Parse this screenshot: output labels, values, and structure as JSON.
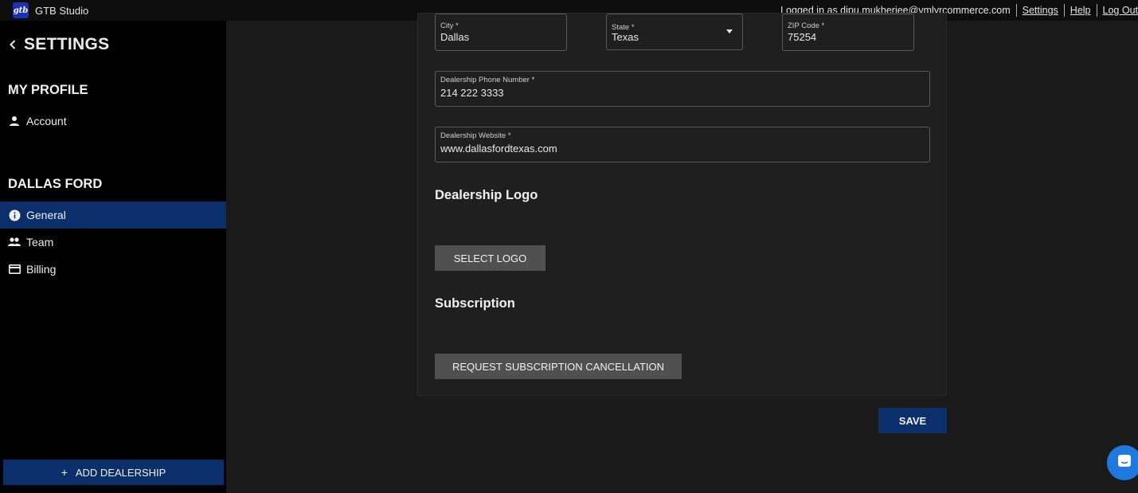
{
  "header": {
    "logo_text": "gtb",
    "app_title": "GTB Studio",
    "logged_in_text": "Logged in as dipu.mukherjee@vmlyrcommerce.com",
    "settings_link": "Settings",
    "help_link": "Help",
    "logout_link": "Log Out"
  },
  "sidebar": {
    "title": "SETTINGS",
    "profile_section": "MY PROFILE",
    "profile_items": [
      {
        "label": "Account",
        "icon": "person-icon"
      }
    ],
    "dealer_section": "DALLAS FORD",
    "dealer_items": [
      {
        "label": "General",
        "icon": "info-icon",
        "active": true
      },
      {
        "label": "Team",
        "icon": "group-icon"
      },
      {
        "label": "Billing",
        "icon": "credit-card-icon"
      }
    ],
    "add_dealership": "ADD DEALERSHIP"
  },
  "form": {
    "city": {
      "label": "City *",
      "value": "Dallas"
    },
    "state": {
      "label": "State *",
      "value": "Texas"
    },
    "zip": {
      "label": "ZIP Code *",
      "value": "75254"
    },
    "phone": {
      "label": "Dealership Phone Number *",
      "value": "214 222 3333"
    },
    "website": {
      "label": "Dealership Website *",
      "value": "www.dallasfordtexas.com"
    },
    "logo_heading": "Dealership Logo",
    "select_logo": "SELECT LOGO",
    "subscription_heading": "Subscription",
    "cancel_subscription": "REQUEST SUBSCRIPTION CANCELLATION",
    "save": "SAVE"
  },
  "colors": {
    "accent": "#0b2f6b",
    "sidebar_bg": "#000000",
    "main_bg": "#1a1a1a",
    "chat": "#1f7ae0"
  }
}
